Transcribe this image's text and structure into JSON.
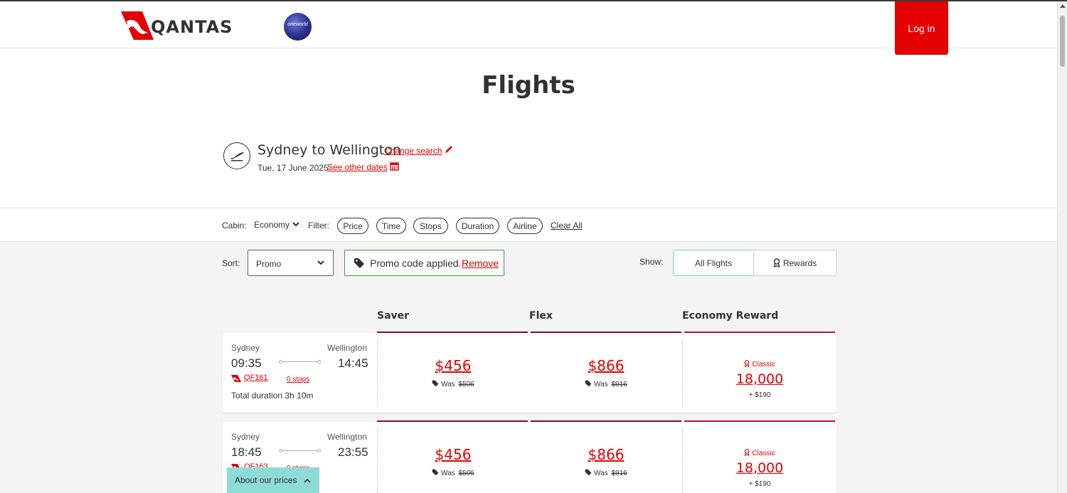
{
  "header": {
    "brand": "QANTAS",
    "alliance": "oneworld",
    "login_label": "Log in",
    "colors": {
      "brand_red": "#e40000",
      "accent_teal": "#8ddbd6"
    }
  },
  "page_title": "Flights",
  "route": {
    "title": "Sydney to Wellington",
    "change_search": "Change search",
    "date": "Tue, 17 June 2025",
    "see_other_dates": "See other dates"
  },
  "filters": {
    "cabin_label": "Cabin:",
    "cabin_value": "Economy",
    "filter_label": "Filter:",
    "pills": [
      "Price",
      "Time",
      "Stops",
      "Duration",
      "Airline"
    ],
    "clear_all": "Clear All"
  },
  "sort": {
    "label": "Sort:",
    "value": "Promo"
  },
  "promo": {
    "text": "Promo code applied.",
    "remove": "Remove"
  },
  "show": {
    "label": "Show:",
    "all_flights": "All Flights",
    "rewards": "Rewards"
  },
  "columns": [
    "Saver",
    "Flex",
    "Economy Reward"
  ],
  "flights": [
    {
      "from": "Sydney",
      "to": "Wellington",
      "depart": "09:35",
      "arrive": "14:45",
      "code": "QF161",
      "stops": "0 stops",
      "duration": "Total duration 3h 10m",
      "saver": {
        "price": "$456",
        "was_label": "Was",
        "was": "$506"
      },
      "flex": {
        "price": "$866",
        "was_label": "Was",
        "was": "$916"
      },
      "reward": {
        "type": "Classic",
        "points": "18,000",
        "plus": "+ $190"
      }
    },
    {
      "from": "Sydney",
      "to": "Wellington",
      "depart": "18:45",
      "arrive": "23:55",
      "code": "QF163",
      "stops": "0 stops",
      "duration": "",
      "saver": {
        "price": "$456",
        "was_label": "Was",
        "was": "$506"
      },
      "flex": {
        "price": "$866",
        "was_label": "Was",
        "was": "$916"
      },
      "reward": {
        "type": "Classic",
        "points": "18,000",
        "plus": "+ $190"
      }
    }
  ],
  "about_prices": "About our prices"
}
